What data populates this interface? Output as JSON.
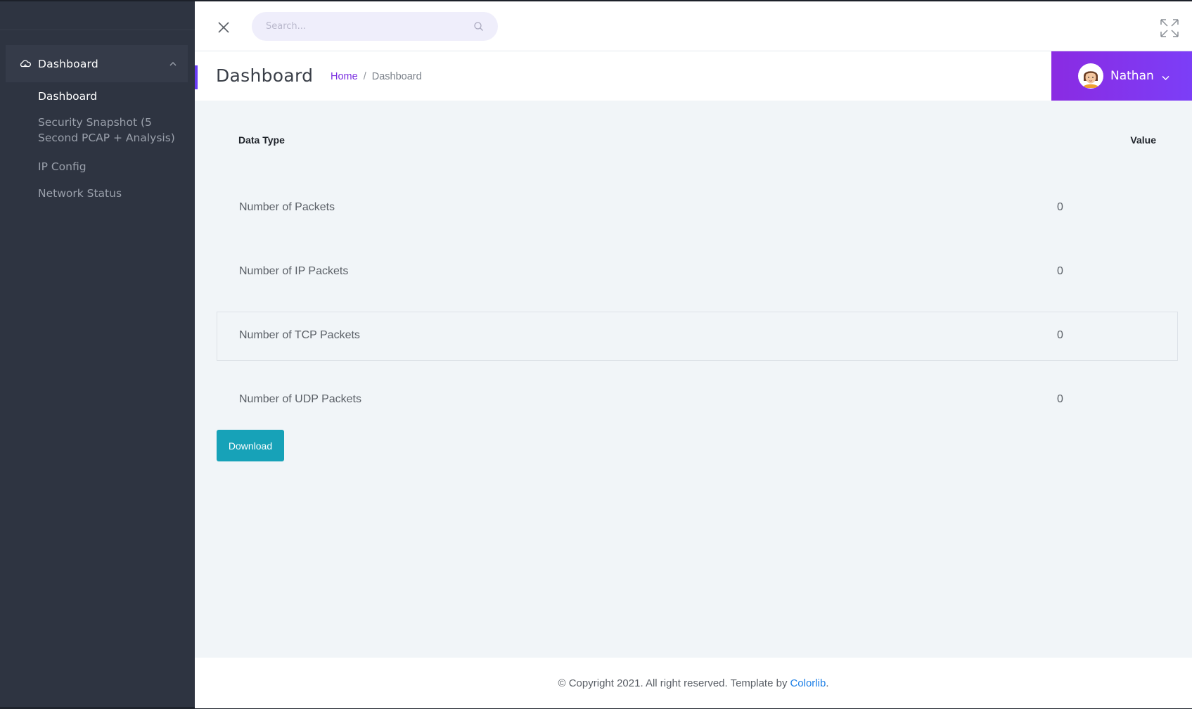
{
  "sidebar": {
    "group": {
      "label": "Dashboard",
      "icon": "cloud-icon",
      "expanded": true
    },
    "items": [
      {
        "label": "Dashboard",
        "active": true
      },
      {
        "label": "Security Snapshot (5 Second PCAP + Analysis)",
        "active": false
      },
      {
        "label": "IP Config",
        "active": false
      },
      {
        "label": "Network Status",
        "active": false
      }
    ]
  },
  "topbar": {
    "search_placeholder": "Search...",
    "search_value": ""
  },
  "header": {
    "page_title": "Dashboard",
    "breadcrumb": {
      "home": "Home",
      "separator": "/",
      "current": "Dashboard"
    },
    "user": {
      "name": "Nathan"
    }
  },
  "table": {
    "columns": [
      "Data Type",
      "Value"
    ],
    "rows": [
      {
        "type": "Number of Packets",
        "value": "0"
      },
      {
        "type": "Number of IP Packets",
        "value": "0"
      },
      {
        "type": "Number of TCP Packets",
        "value": "0"
      },
      {
        "type": "Number of UDP Packets",
        "value": "0"
      }
    ]
  },
  "actions": {
    "download_label": "Download"
  },
  "footer": {
    "text": "© Copyright 2021. All right reserved. Template by",
    "link": "Colorlib",
    "suffix": "."
  },
  "colors": {
    "sidebar_bg": "#2e3441",
    "accent_purple": "#7c3ef7",
    "breadcrumb_link": "#7a2ee0",
    "download_button": "#17a2b8",
    "footer_link": "#1c7fe6"
  }
}
